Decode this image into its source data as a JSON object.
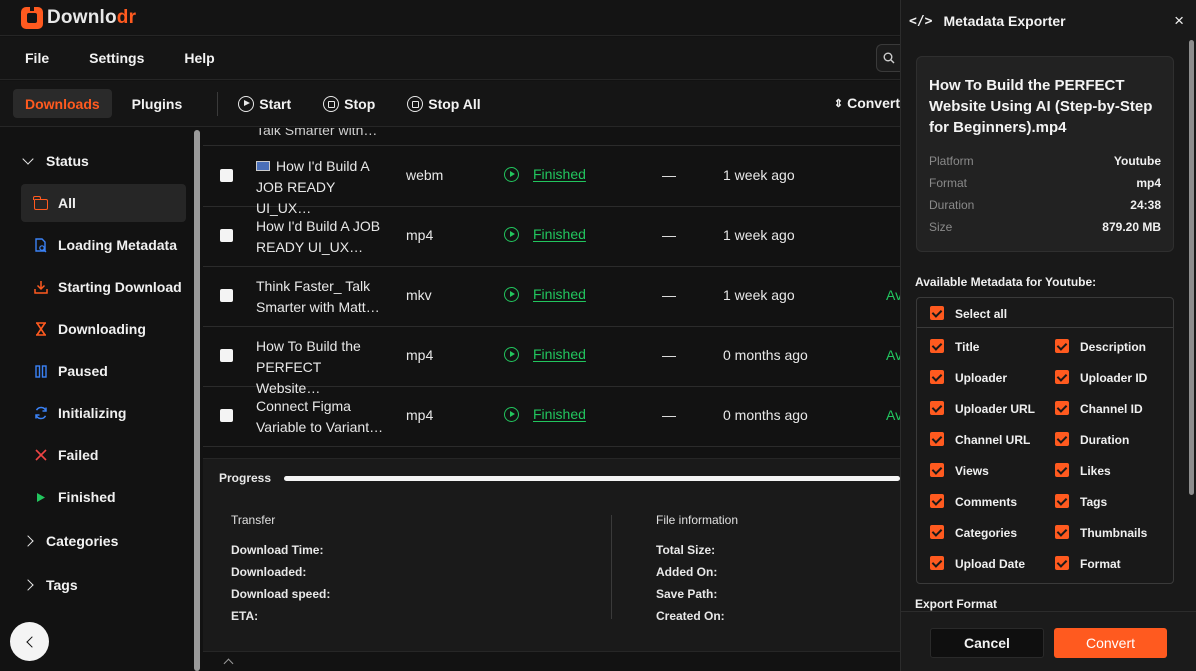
{
  "app": {
    "brand_main": "Downlo",
    "brand_accent": "dr",
    "accent_color": "#ff5a1f"
  },
  "menu": {
    "items": [
      "File",
      "Settings",
      "Help"
    ]
  },
  "toolbar": {
    "tabs": [
      "Downloads",
      "Plugins"
    ],
    "start_label": "Start",
    "stop_label": "Stop",
    "stop_all_label": "Stop All",
    "convert_label": "Convert"
  },
  "sidebar": {
    "status_label": "Status",
    "items": [
      {
        "label": "All",
        "icon": "folder-icon"
      },
      {
        "label": "Loading Metadata",
        "icon": "doc-search-icon"
      },
      {
        "label": "Starting Download",
        "icon": "download-icon"
      },
      {
        "label": "Downloading",
        "icon": "hourglass-icon"
      },
      {
        "label": "Paused",
        "icon": "pause-icon"
      },
      {
        "label": "Initializing",
        "icon": "refresh-icon"
      },
      {
        "label": "Failed",
        "icon": "x-icon"
      },
      {
        "label": "Finished",
        "icon": "play-icon"
      }
    ],
    "categories_label": "Categories",
    "tags_label": "Tags"
  },
  "table": {
    "cut_row_title": "Talk Smarter with…",
    "rows": [
      {
        "title_l1": "How I'd Build A",
        "title_l2": "JOB READY UI_UX…",
        "format": "webm",
        "status": "Finished",
        "dash": "—",
        "date": "1 week ago",
        "avail": ""
      },
      {
        "title_l1": "How I'd Build A JOB",
        "title_l2": "READY UI_UX…",
        "format": "mp4",
        "status": "Finished",
        "dash": "—",
        "date": "1 week ago",
        "avail": ""
      },
      {
        "title_l1": "Think Faster_ Talk",
        "title_l2": "Smarter with Matt…",
        "format": "mkv",
        "status": "Finished",
        "dash": "—",
        "date": "1 week ago",
        "avail": "Av"
      },
      {
        "title_l1": "How To Build the",
        "title_l2": "PERFECT Website…",
        "format": "mp4",
        "status": "Finished",
        "dash": "—",
        "date": "0 months ago",
        "avail": "Av"
      },
      {
        "title_l1": "Connect Figma",
        "title_l2": "Variable to Variant…",
        "format": "mp4",
        "status": "Finished",
        "dash": "—",
        "date": "0 months ago",
        "avail": "Av"
      }
    ]
  },
  "progress": {
    "label": "Progress",
    "value_fraction": 1.0,
    "transfer": {
      "title": "Transfer",
      "keys": [
        "Download Time:",
        "Downloaded:",
        "Download speed:",
        "ETA:"
      ]
    },
    "file_info": {
      "title": "File information",
      "keys": [
        "Total Size:",
        "Added On:",
        "Save Path:",
        "Created On:"
      ]
    }
  },
  "panel": {
    "header_icon": "</>",
    "title": "Metadata Exporter",
    "close": "×",
    "file_title": "How To Build the PERFECT Website Using AI (Step-by-Step for Beginners).mp4",
    "fields": [
      {
        "key": "Platform",
        "value": "Youtube"
      },
      {
        "key": "Format",
        "value": "mp4"
      },
      {
        "key": "Duration",
        "value": "24:38"
      },
      {
        "key": "Size",
        "value": "879.20 MB"
      }
    ],
    "available_label": "Available Metadata for Youtube:",
    "select_all": "Select all",
    "options_left": [
      "Title",
      "Uploader",
      "Uploader URL",
      "Channel URL",
      "Views",
      "Comments",
      "Categories",
      "Upload Date"
    ],
    "options_right": [
      "Description",
      "Uploader ID",
      "Channel ID",
      "Duration",
      "Likes",
      "Tags",
      "Thumbnails",
      "Format"
    ],
    "export_format_label": "Export Format",
    "cancel_label": "Cancel",
    "convert_label": "Convert"
  }
}
